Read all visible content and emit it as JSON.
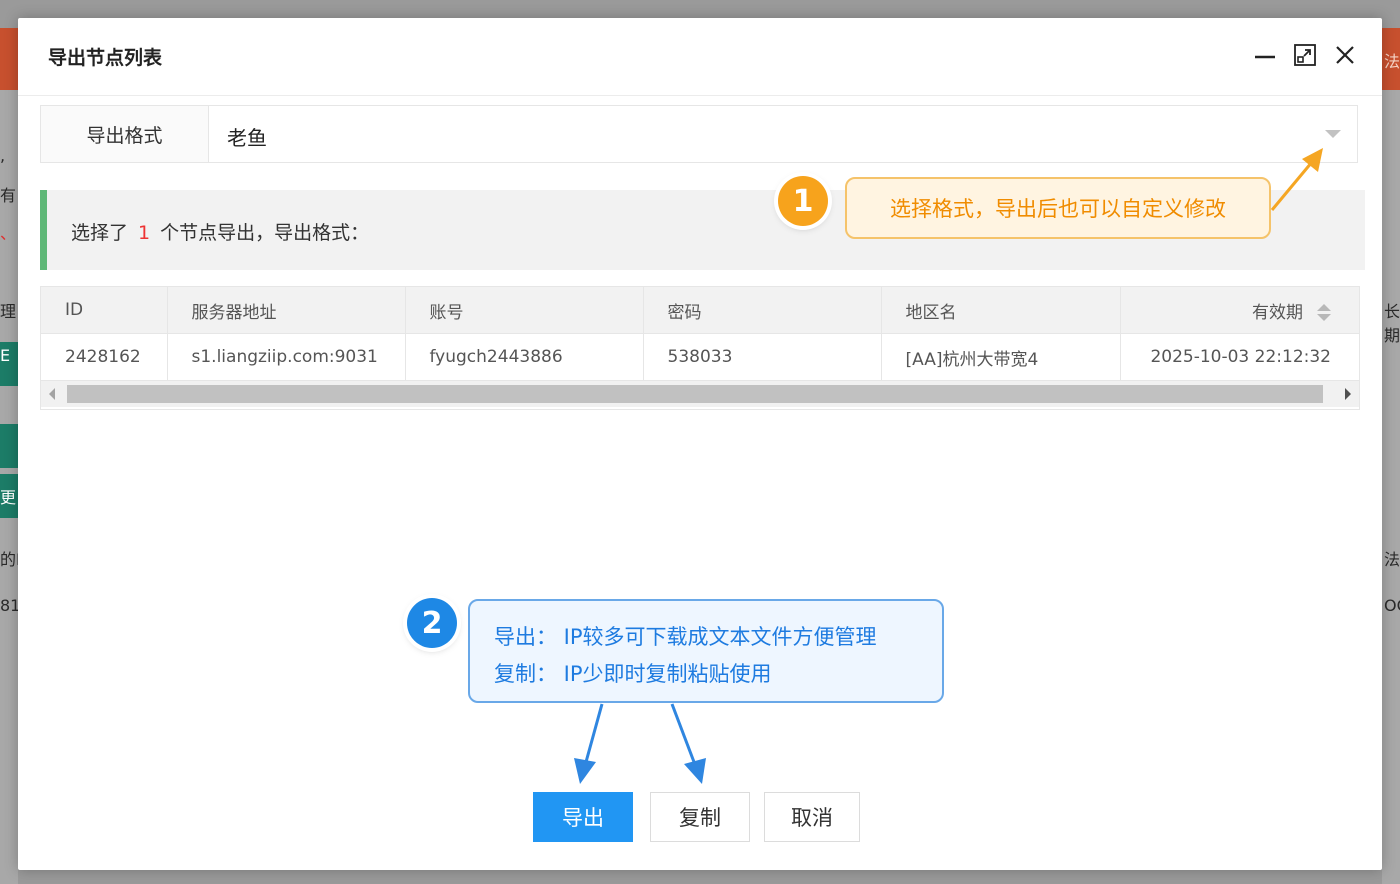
{
  "background": {
    "left_frags": [
      ",",
      "有",
      "、",
      "理",
      "E",
      "更",
      "的ID",
      "81"
    ],
    "right_frags": [
      "法",
      "长期",
      "法",
      "OC"
    ]
  },
  "dialog": {
    "title": "导出节点列表",
    "header_icons": [
      "minimize-icon",
      "maximize-icon",
      "close-icon"
    ],
    "format_label": "导出格式",
    "format_value": "老鱼",
    "info": {
      "prefix": "选择了",
      "count": "1",
      "suffix": "个节点导出，导出格式："
    },
    "table": {
      "columns": [
        "ID",
        "服务器地址",
        "账号",
        "密码",
        "地区名",
        "有效期"
      ],
      "rows": [
        [
          "2428162",
          "s1.liangziip.com:9031",
          "fyugch2443886",
          "538033",
          "[AA]杭州大带宽4",
          "2025-10-03 22:12:32"
        ]
      ]
    },
    "callout_1": {
      "badge": "1",
      "text": "选择格式，导出后也可以自定义修改"
    },
    "callout_2": {
      "badge": "2",
      "line1": "导出：  IP较多可下载成文本文件方便管理",
      "line2": "复制：  IP少即时复制粘贴使用"
    },
    "buttons": {
      "export": "导出",
      "copy": "复制",
      "cancel": "取消"
    }
  },
  "colors": {
    "primary": "#2196f3",
    "accent_green": "#5fb878",
    "highlight_red": "#ee3333",
    "callout_orange": "#f08c00",
    "callout_blue": "#1e7be0"
  }
}
